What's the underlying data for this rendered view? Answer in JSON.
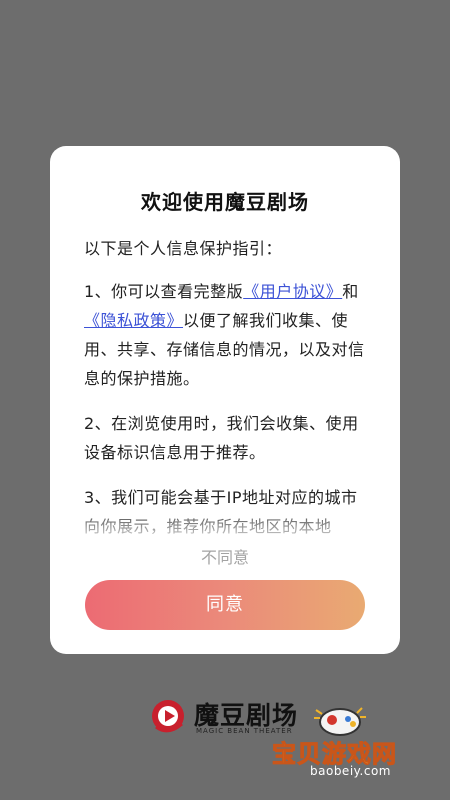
{
  "dialog": {
    "title": "欢迎使用魔豆剧场",
    "intro": "以下是个人信息保护指引：",
    "item1_prefix": "1、你可以查看完整版",
    "user_agreement_link": "《用户协议》",
    "item1_and": "和",
    "privacy_policy_link": "《隐私政策》",
    "item1_suffix": "以便了解我们收集、使用、共享、存储信息的情况，以及对信息的保护措施。",
    "item2": "2、在浏览使用时，我们会收集、使用设备标识信息用于推荐。",
    "item3": "3、我们可能会基于IP地址对应的城市向你展示，推荐你所在地区的本地",
    "disagree_label": "不同意",
    "agree_label": "同意"
  },
  "brand": {
    "name": "魔豆剧场",
    "english": "MAGIC BEAN THEATER",
    "icon": "play-logo-icon"
  },
  "watermark": {
    "title": "宝贝游戏网",
    "url": "baobeiy.com",
    "icon": "gamepad-mascot-icon"
  },
  "colors": {
    "backdrop": "#6d6d6d",
    "link": "#3c52d6",
    "agree_gradient_start": "#ec6b73",
    "agree_gradient_end": "#e9aa72",
    "disagree_text": "#a3a3a3",
    "brand_red": "#c8202d"
  }
}
